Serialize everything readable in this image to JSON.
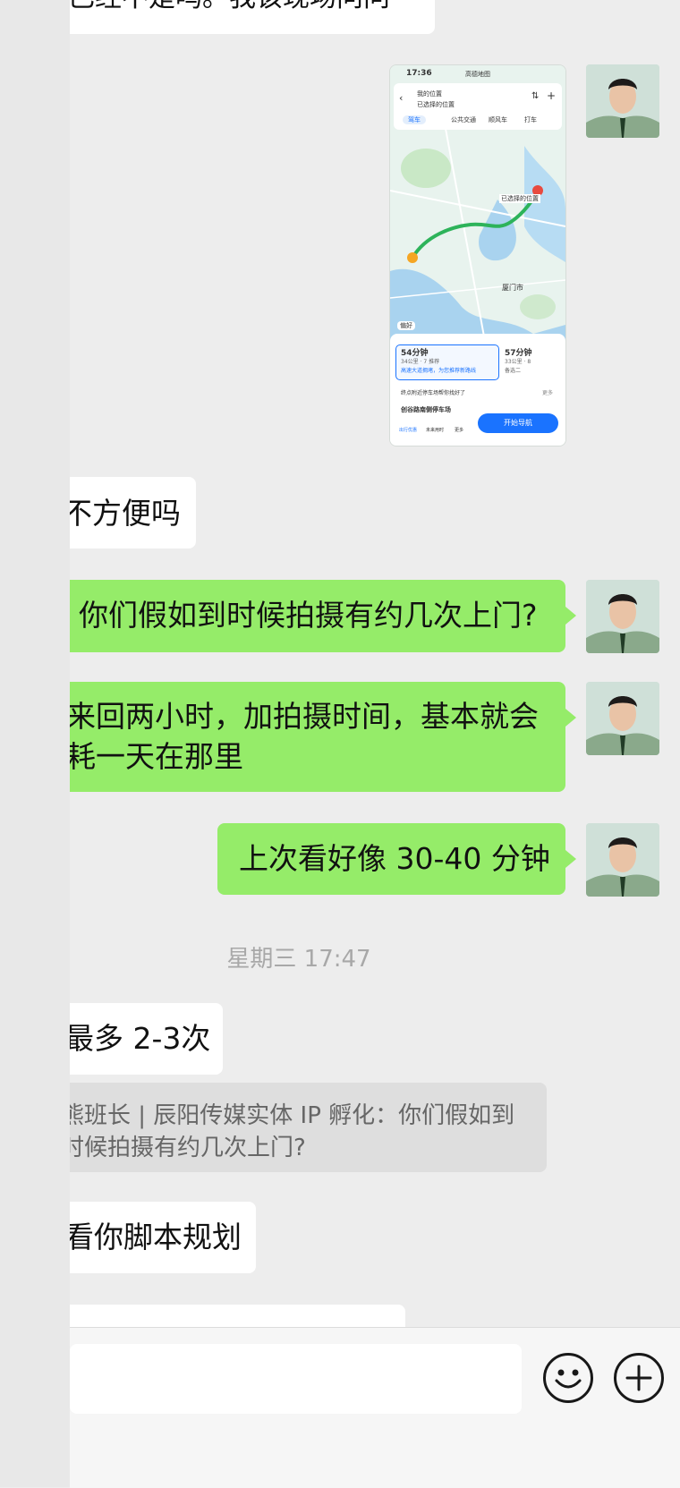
{
  "messages": {
    "top_partial": "已经不是吗。我该现场问问",
    "msg_inconvenient": "不方便吗",
    "msg_how_many_visits": "你们假如到时候拍摄有约几次上门?",
    "msg_roundtrip_line1": "来回两小时，加拍摄时间，基本就会",
    "msg_roundtrip_line2": "耗一天在那里",
    "msg_last_time": "上次看好像 30-40 分钟",
    "timestamp": "星期三 17:47",
    "msg_at_most": "最多 2-3次",
    "quote_line1": "熊班长 | 辰阳传媒实体 IP 孵化：你们假如到",
    "quote_line2": "时候拍摄有约几次上门?",
    "msg_see_script": "看你脚本规划"
  },
  "map_screenshot": {
    "status_time": "17:36",
    "status_app": "高德地图",
    "my_location": "我的位置",
    "selected_location": "已选择的位置",
    "mode_drive": "驾车",
    "mode_transit": "公共交通",
    "mode_ride": "顺风车",
    "mode_taxi": "打车",
    "route_label": "已选择的位置",
    "city_label": "厦门市",
    "route1_time": "54分钟",
    "route1_info": "34公里 · 7 推荐",
    "route1_note": "高速大道拥堵，为您推荐新路线",
    "route2_time": "57分钟",
    "route2_info": "33公里 · 8",
    "route2_note": "备选二",
    "parking_tip": "终点附近停车场帮你找好了",
    "parking_name": "创谷路南侧停车场",
    "tab1": "出行优惠",
    "tab2": "未来用时",
    "tab3": "更多",
    "nav_button": "开始导航",
    "pref_label": "偏好",
    "more": "更多"
  },
  "icons": {
    "emoji": "emoji-icon",
    "plus": "plus-icon"
  },
  "colors": {
    "green_bubble": "#95ec69",
    "white_bubble": "#ffffff",
    "background": "#ededed",
    "nav_blue": "#1a73ff"
  }
}
